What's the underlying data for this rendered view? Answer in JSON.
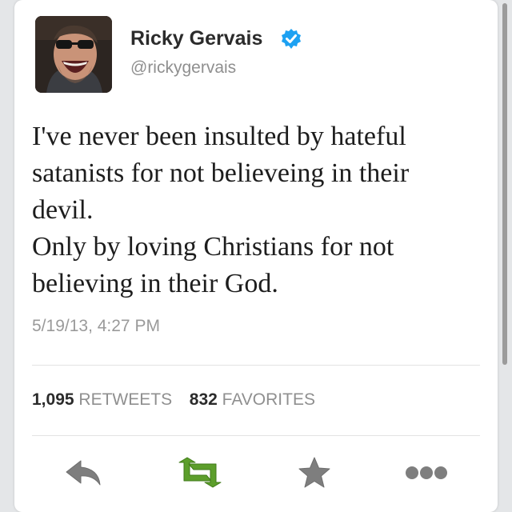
{
  "user": {
    "name": "Ricky Gervais",
    "handle": "@rickygervais",
    "verified": true
  },
  "tweet": {
    "lines": [
      "I've never been insulted by hateful",
      "satanists for not believeing in their",
      "devil.",
      "Only by loving Christians for not",
      "believing in their God."
    ],
    "timestamp": "5/19/13, 4:27 PM"
  },
  "stats": {
    "retweets_count": "1,095",
    "retweets_label": "RETWEETS",
    "favorites_count": "832",
    "favorites_label": "FAVORITES"
  },
  "actions": [
    {
      "icon": "reply-icon"
    },
    {
      "icon": "retweet-icon"
    },
    {
      "icon": "favorite-star-icon"
    },
    {
      "icon": "more-dots-icon"
    }
  ],
  "colors": {
    "background": "#e4e6e8",
    "card": "#ffffff",
    "verified_badge": "#1da1f2",
    "retweet_green": "#5c9e2b",
    "icon_gray": "#7e7e7e",
    "muted_text": "#8f8f8f"
  }
}
